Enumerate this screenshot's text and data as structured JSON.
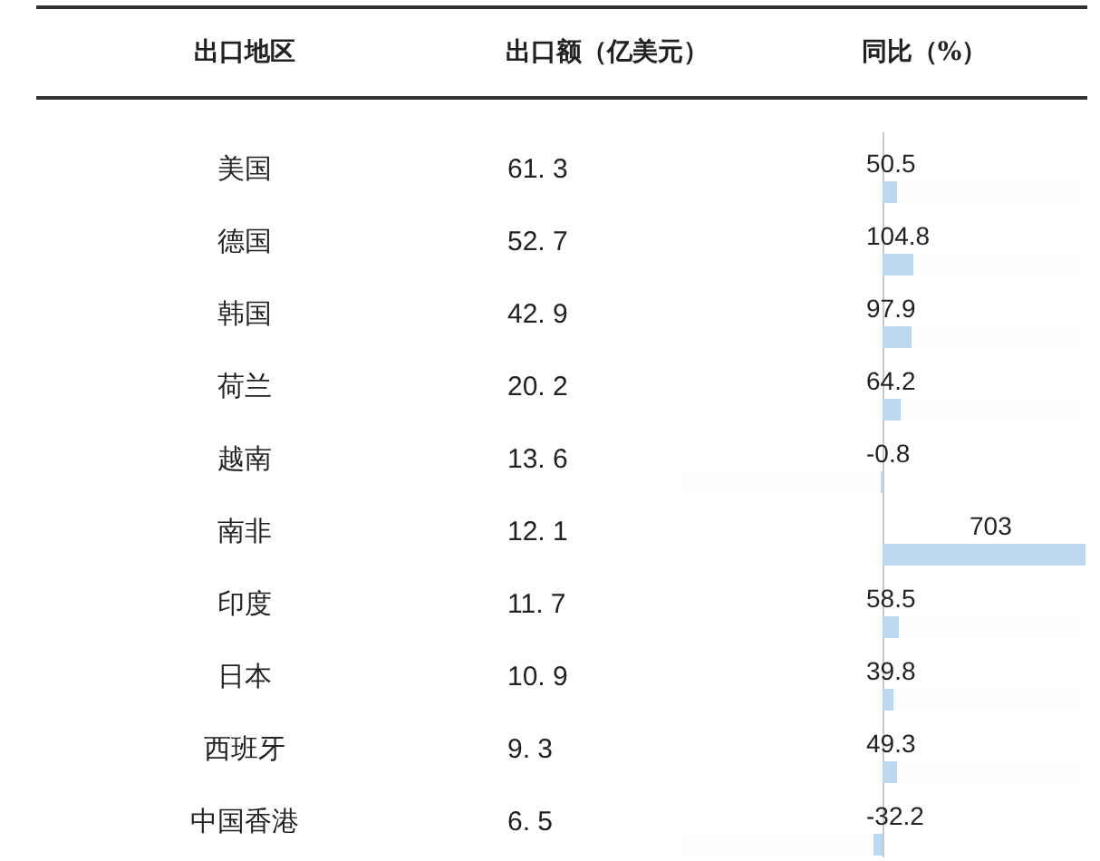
{
  "table": {
    "columns": [
      "出口地区",
      "出口额（亿美元）",
      "同比（%）"
    ],
    "rows": [
      {
        "region": "美国",
        "amount": "61. 3",
        "yoy": "50.5",
        "kind": "positive",
        "level": 0.0718
      },
      {
        "region": "德国",
        "amount": "52. 7",
        "yoy": "104.8",
        "kind": "positive",
        "level": 0.1491
      },
      {
        "region": "韩国",
        "amount": "42. 9",
        "yoy": "97.9",
        "kind": "positive",
        "level": 0.1393
      },
      {
        "region": "荷兰",
        "amount": "20. 2",
        "yoy": "64.2",
        "kind": "positive",
        "level": 0.0913
      },
      {
        "region": "越南",
        "amount": "13. 6",
        "yoy": "-0.8",
        "kind": "negative",
        "level": 0.0011
      },
      {
        "region": "南非",
        "amount": "12. 1",
        "yoy": "703",
        "kind": "positive",
        "level": 1
      },
      {
        "region": "印度",
        "amount": "11. 7",
        "yoy": "58.5",
        "kind": "positive",
        "level": 0.0832
      },
      {
        "region": "日本",
        "amount": "10. 9",
        "yoy": "39.8",
        "kind": "positive",
        "level": 0.0566
      },
      {
        "region": "西班牙",
        "amount": "9. 3",
        "yoy": "49.3",
        "kind": "positive",
        "level": 0.0701
      },
      {
        "region": "中国香港",
        "amount": "6. 5",
        "yoy": "-32.2",
        "kind": "negative",
        "level": 0.0458
      }
    ]
  }
}
